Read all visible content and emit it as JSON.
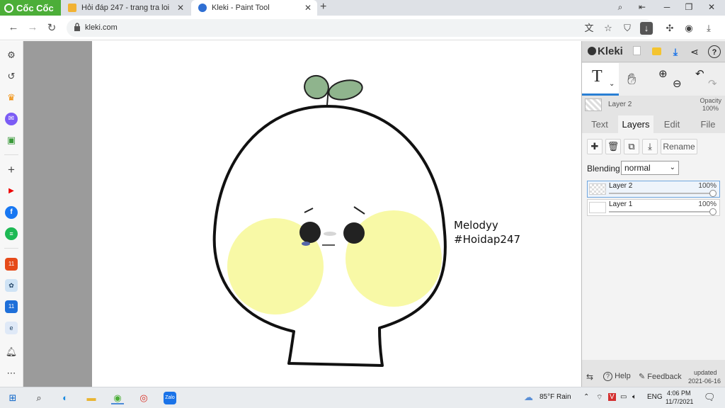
{
  "browser": {
    "brand": "Cốc Cốc",
    "tabs": [
      {
        "title": "Hỏi đáp 247 - trang tra loi",
        "icon": "hoidap-favicon"
      },
      {
        "title": "Kleki - Paint Tool",
        "icon": "kleki-favicon",
        "active": true
      }
    ],
    "url": "kleki.com",
    "new_tab": "+",
    "window_controls": [
      "minimize-icon",
      "maximize-icon",
      "close-icon"
    ]
  },
  "sidebar_icons": [
    "gear-icon",
    "history-icon",
    "crown-icon",
    "messenger-icon",
    "game-icon",
    "add-icon",
    "youtube-icon",
    "facebook-icon",
    "spotify-icon",
    "shop-icon",
    "app-icon",
    "sale-icon",
    "news-icon",
    "bell-icon",
    "more-icon"
  ],
  "drawing": {
    "signature_name": "Melodyy",
    "signature_tag": "#Hoidap247"
  },
  "kleki": {
    "logo": "Kleki",
    "tool_text_glyph": "T",
    "layer_info": {
      "name": "Layer 2",
      "opacity_label": "Opacity",
      "opacity_value": "100%"
    },
    "tabs": [
      "Text",
      "Layers",
      "Edit",
      "File"
    ],
    "active_tab": "Layers",
    "rename": "Rename",
    "blending_label": "Blending",
    "blending_value": "normal",
    "layers": [
      {
        "name": "Layer 2",
        "opacity": "100%",
        "selected": true
      },
      {
        "name": "Layer 1",
        "opacity": "100%",
        "selected": false
      }
    ],
    "footer": {
      "help": "Help",
      "feedback": "Feedback",
      "updated_label": "updated",
      "updated_date": "2021-06-16"
    }
  },
  "taskbar": {
    "weather": "85°F  Rain",
    "lang": "ENG",
    "time": "4:06 PM",
    "date": "11/7/2021"
  }
}
